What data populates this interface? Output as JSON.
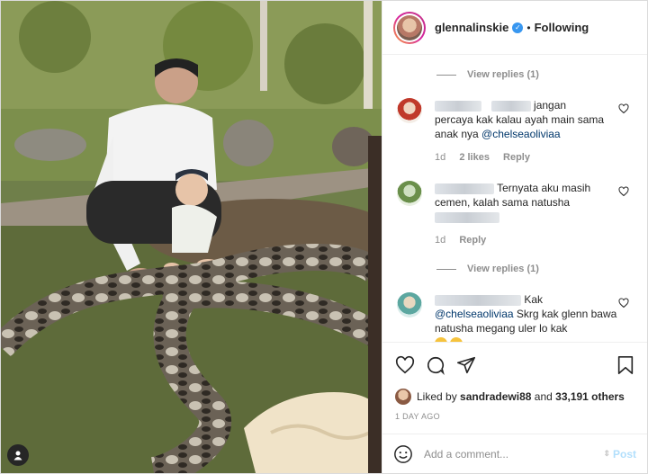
{
  "header": {
    "username": "glennalinskie",
    "verified_icon": "verified-badge-icon",
    "separator": "•",
    "following_label": "Following"
  },
  "comments": {
    "view_replies_1": "View replies (1)",
    "comment1": {
      "text_line1": "jangan",
      "text_rest": "percaya kak kalau ayah main sama anak nya",
      "mention": "@chelseaoliviaa",
      "time": "1d",
      "likes": "2 likes",
      "reply": "Reply"
    },
    "comment2": {
      "text_line1": "Ternyata aku masih cemen, kalah sama natusha",
      "time": "1d",
      "reply": "Reply"
    },
    "view_replies_2": "View replies (1)",
    "comment3": {
      "text_line1": "Kak",
      "mention": "@chelseaoliviaa",
      "text_rest": "Skrg kak glenn bawa natusha megang uler lo kak"
    }
  },
  "likes": {
    "prefix": "Liked by",
    "user": "sandradewi88",
    "and": "and",
    "others": "33,191 others"
  },
  "timestamp": "1 DAY AGO",
  "add_comment": {
    "placeholder": "Add a comment...",
    "post_label": "Post"
  },
  "colors": {
    "accent_link": "#00376b",
    "verified": "#3897f0",
    "post_disabled": "#b2dffc"
  }
}
